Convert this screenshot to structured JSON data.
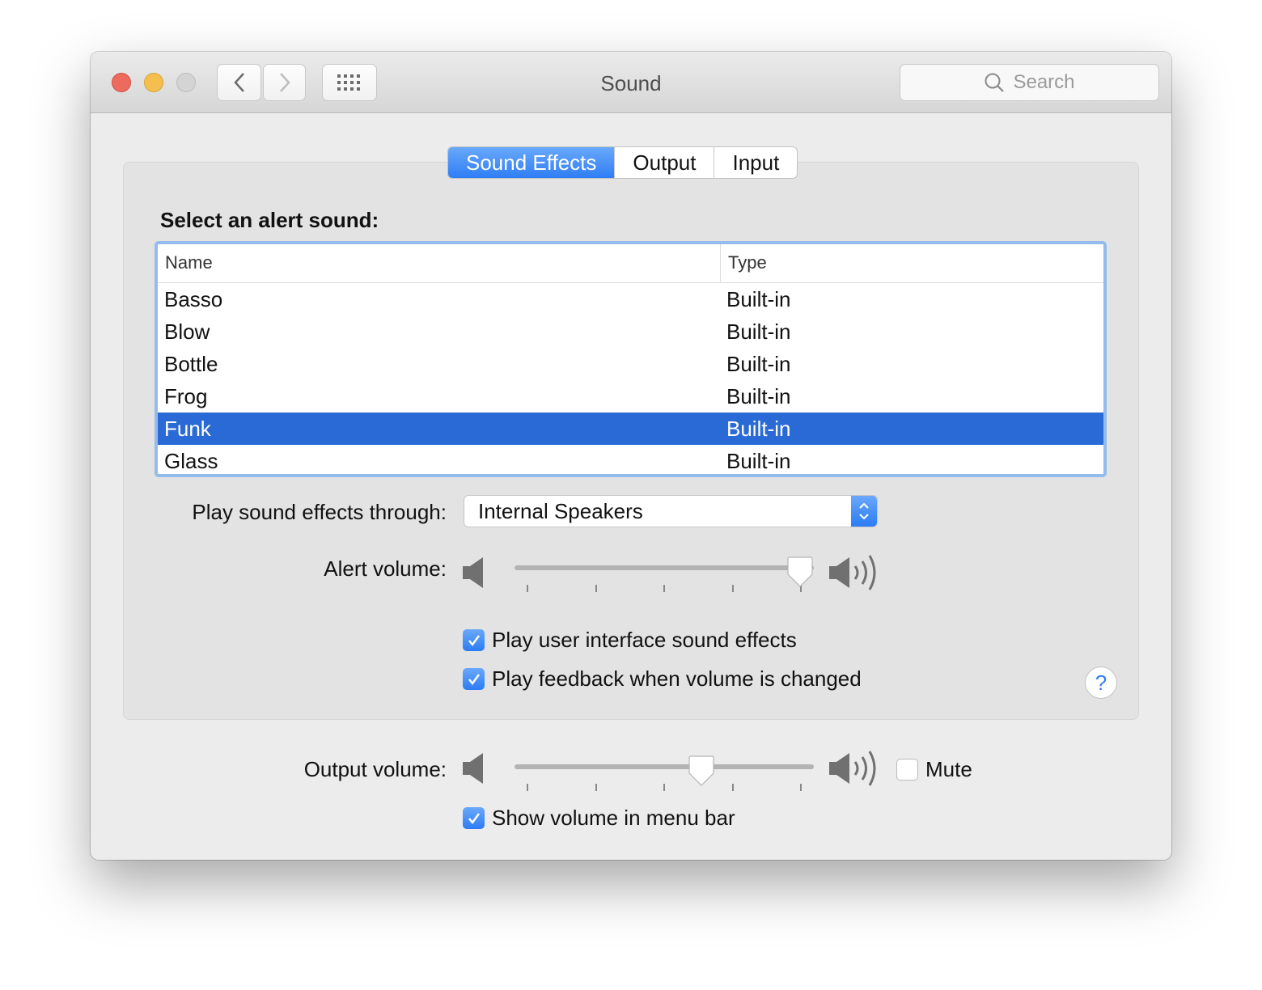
{
  "window": {
    "title": "Sound",
    "search_placeholder": "Search"
  },
  "tabs": [
    {
      "label": "Sound Effects",
      "active": true
    },
    {
      "label": "Output"
    },
    {
      "label": "Input"
    }
  ],
  "alert": {
    "heading": "Select an alert sound:",
    "columns": [
      "Name",
      "Type"
    ],
    "rows": [
      {
        "name": "Basso",
        "type": "Built-in"
      },
      {
        "name": "Blow",
        "type": "Built-in"
      },
      {
        "name": "Bottle",
        "type": "Built-in"
      },
      {
        "name": "Frog",
        "type": "Built-in"
      },
      {
        "name": "Funk",
        "type": "Built-in",
        "selected": true
      },
      {
        "name": "Glass",
        "type": "Built-in"
      }
    ]
  },
  "play_through": {
    "label": "Play sound effects through:",
    "value": "Internal Speakers"
  },
  "alert_volume": {
    "label": "Alert volume:",
    "value": 1.0
  },
  "checks": {
    "ui_effects": {
      "label": "Play user interface sound effects",
      "checked": true
    },
    "feedback": {
      "label": "Play feedback when volume is changed",
      "checked": true
    },
    "menu_bar": {
      "label": "Show volume in menu bar",
      "checked": true
    },
    "mute": {
      "label": "Mute",
      "checked": false
    }
  },
  "output_volume": {
    "label": "Output volume:",
    "value": 0.64
  },
  "help": "?",
  "colors": {
    "accent": "#2f7ef5",
    "selection": "#2a6ad6"
  }
}
